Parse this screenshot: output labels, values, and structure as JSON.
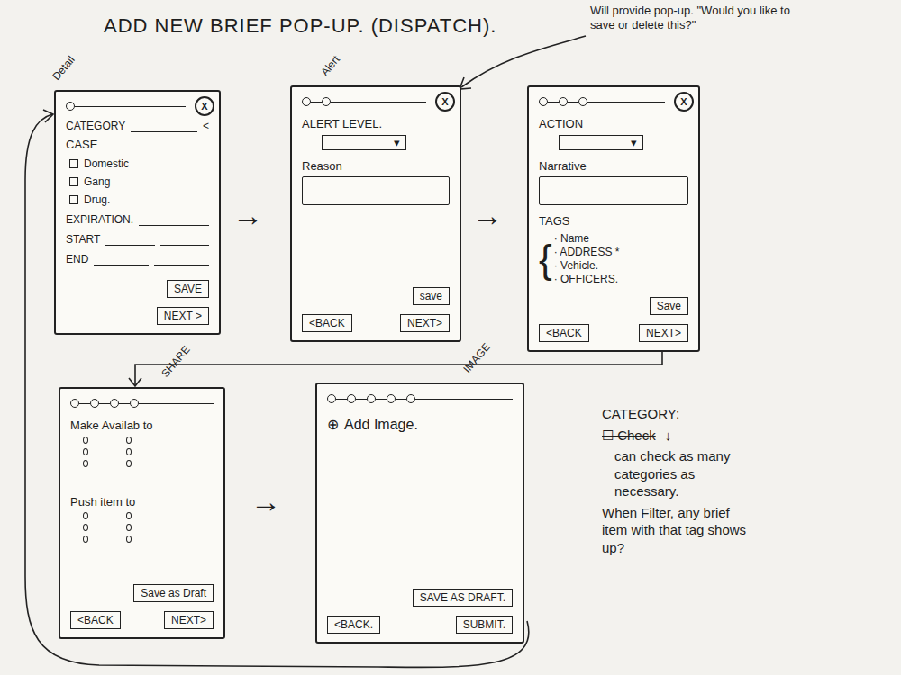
{
  "title": "ADD NEW BRIEF POP-UP. (DISPATCH).",
  "annotation": "Will provide pop-up. \"Would you like to save or delete this?\"",
  "close_glyph": "X",
  "arrow_glyph": "→",
  "screens": [
    {
      "label": "Detail",
      "step": 1,
      "closable": true,
      "elements": [
        {
          "kind": "field",
          "text": "CATEGORY",
          "blanks": 1,
          "suffix": "<"
        },
        {
          "kind": "heading",
          "text": "CASE"
        },
        {
          "kind": "checkbox",
          "text": "Domestic",
          "checked": false
        },
        {
          "kind": "checkbox",
          "text": "Gang",
          "checked": false
        },
        {
          "kind": "checkbox",
          "text": "Drug.",
          "checked": false
        },
        {
          "kind": "field",
          "text": "EXPIRATION.",
          "blanks": 1,
          "suffix": ""
        },
        {
          "kind": "field",
          "text": "START",
          "blanks": 2,
          "suffix": ""
        },
        {
          "kind": "field",
          "text": "END",
          "blanks": 2,
          "suffix": ""
        }
      ],
      "save": "SAVE",
      "back": null,
      "next": "NEXT >"
    },
    {
      "label": "Alert",
      "step": 2,
      "closable": true,
      "elements": [
        {
          "kind": "dropdown",
          "text": "ALERT LEVEL.",
          "caret": "▾"
        },
        {
          "kind": "textbox",
          "text": "Reason"
        }
      ],
      "save": "save",
      "back": "<BACK",
      "next": "NEXT>"
    },
    {
      "label": "",
      "step": 3,
      "closable": true,
      "elements": [
        {
          "kind": "dropdown",
          "text": "ACTION",
          "caret": "▾"
        },
        {
          "kind": "textbox",
          "text": "Narrative"
        },
        {
          "kind": "tags",
          "text": "TAGS",
          "brace": "{",
          "items": [
            "· Name",
            "· ADDRESS *",
            "· Vehicle.",
            "· OFFICERS."
          ]
        }
      ],
      "save": "Save",
      "back": "<BACK",
      "next": "NEXT>"
    },
    {
      "label": "SHARE",
      "step": 4,
      "closable": false,
      "elements": [
        {
          "kind": "marks",
          "text": "Make Availab to",
          "count": 6
        },
        {
          "kind": "divider"
        },
        {
          "kind": "marks",
          "text": "Push item to",
          "count": 6
        }
      ],
      "save": "Save as Draft",
      "back": "<BACK",
      "next": "NEXT>"
    },
    {
      "label": "IMAGE",
      "step": 5,
      "closable": false,
      "elements": [
        {
          "kind": "add",
          "glyph": "⊕",
          "text": "Add Image."
        }
      ],
      "save": "SAVE AS DRAFT.",
      "back": "<BACK.",
      "next": "SUBMIT."
    }
  ],
  "notes": {
    "heading": "CATEGORY:",
    "struck": "☐ Check",
    "arrow": "↓",
    "lines": [
      "can check as many categories as necessary.",
      "When Filter, any brief item with that tag shows up?"
    ]
  }
}
